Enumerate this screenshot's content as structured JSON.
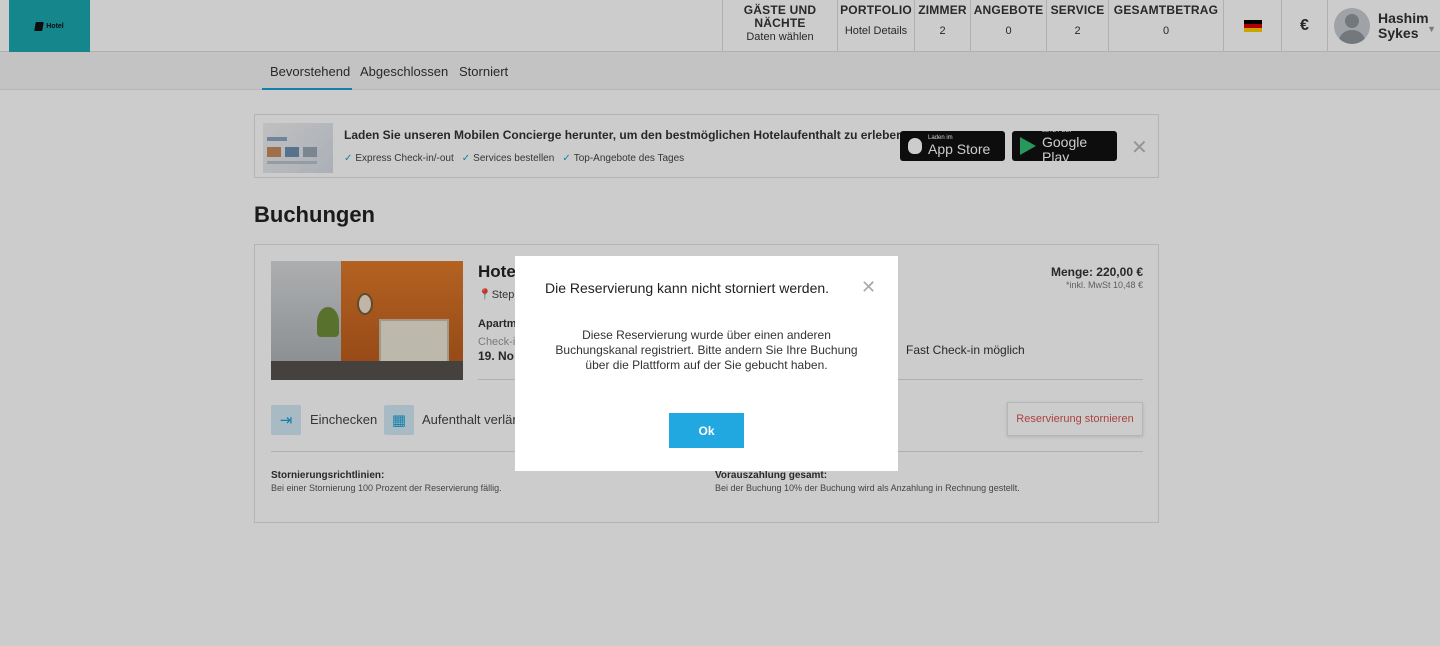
{
  "header": {
    "logo_text": "Hotel",
    "columns": [
      {
        "label": "GÄSTE UND NÄCHTE",
        "value": "Daten wählen"
      },
      {
        "label": "PORTFOLIO",
        "value": "Hotel Details"
      },
      {
        "label": "ZIMMER",
        "value": "2"
      },
      {
        "label": "ANGEBOTE",
        "value": "0"
      },
      {
        "label": "SERVICE",
        "value": "2"
      },
      {
        "label": "GESAMTBETRAG",
        "value": "0"
      }
    ],
    "currency": "€",
    "user_name": "Hashim Sykes",
    "flag_colors": [
      "#000000",
      "#dd0000",
      "#ffce00"
    ]
  },
  "tabs": [
    {
      "label": "Bevorstehend",
      "active": true
    },
    {
      "label": "Abgeschlossen",
      "active": false
    },
    {
      "label": "Storniert",
      "active": false
    }
  ],
  "banner": {
    "title": "Laden Sie unseren Mobilen Concierge herunter, um den bestmöglichen Hotelaufenthalt zu erleben.",
    "features": [
      "Express Check-in/-out",
      "Services bestellen",
      "Top-Angebote des Tages"
    ],
    "appstore_small": "Laden im",
    "appstore_big": "App Store",
    "googleplay_small": "JETZT BEI",
    "googleplay_big": "Google Play"
  },
  "page_title": "Buchungen",
  "booking": {
    "hotel_name": "Hote",
    "address": "Steph",
    "room_type": "Apartm",
    "checkin_label": "Check-i",
    "date": "19. No",
    "feature": "Fast Check-in möglich",
    "price": "Menge: 220,00 €",
    "tax": "*inkl. MwSt  10,48 €",
    "actions": {
      "checkin": "Einchecken",
      "extend": "Aufenthalt verlän",
      "cancel": "Reservierung stornieren"
    },
    "policy_cancel_title": "Stornierungsrichtlinien:",
    "policy_cancel_text": "Bei einer Stornierung 100 Prozent der Reservierung fällig.",
    "policy_prepay_title": "Vorauszahlung gesamt:",
    "policy_prepay_text": "Bei der Buchung 10% der Buchung wird als Anzahlung in Rechnung gestellt."
  },
  "modal": {
    "title": "Die Reservierung kann nicht storniert werden.",
    "body": "Diese Reservierung wurde über einen anderen Buchungskanal registriert. Bitte andern Sie Ihre Buchung über die Plattform auf der Sie gebucht haben.",
    "ok_label": "Ok"
  }
}
